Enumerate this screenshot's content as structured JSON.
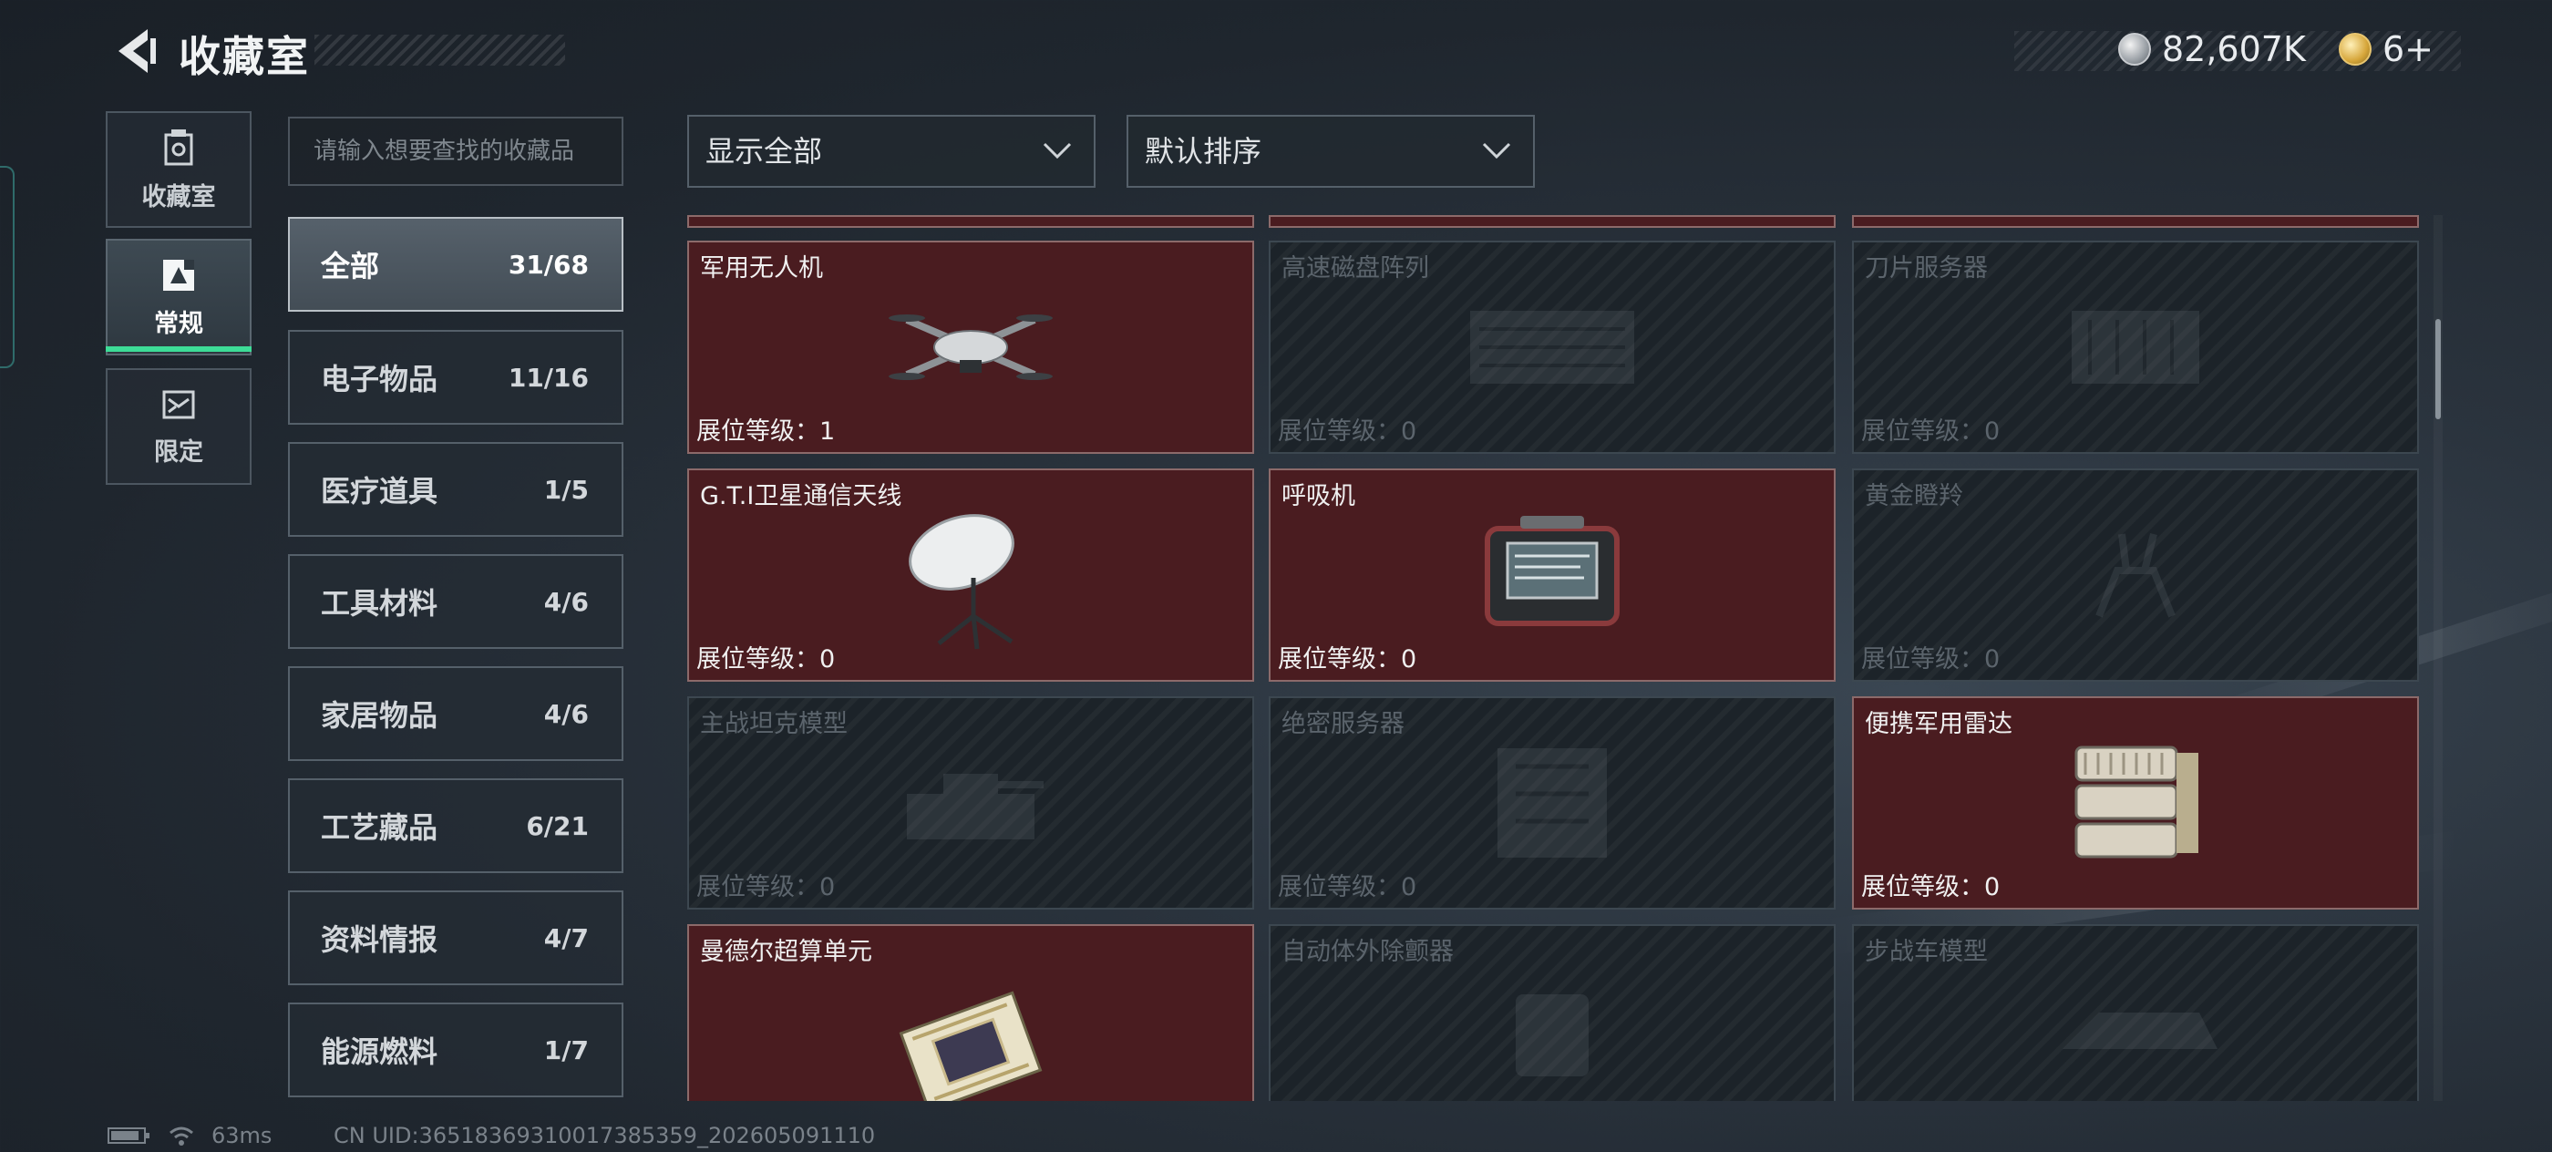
{
  "header": {
    "title": "收藏室",
    "currency": [
      {
        "icon": "silver-coin-icon",
        "value": "82,607K"
      },
      {
        "icon": "gold-coin-icon",
        "value": "6+"
      }
    ]
  },
  "left_nav": [
    {
      "label": "收藏室",
      "icon": "collection-icon",
      "active": false
    },
    {
      "label": "常规",
      "icon": "regular-icon",
      "active": true
    },
    {
      "label": "限定",
      "icon": "limited-icon",
      "active": false
    }
  ],
  "search": {
    "placeholder": "请输入想要查找的收藏品"
  },
  "categories": [
    {
      "name": "全部",
      "count": "31/68",
      "active": true
    },
    {
      "name": "电子物品",
      "count": "11/16",
      "active": false
    },
    {
      "name": "医疗道具",
      "count": "1/5",
      "active": false
    },
    {
      "name": "工具材料",
      "count": "4/6",
      "active": false
    },
    {
      "name": "家居物品",
      "count": "4/6",
      "active": false
    },
    {
      "name": "工艺藏品",
      "count": "6/21",
      "active": false
    },
    {
      "name": "资料情报",
      "count": "4/7",
      "active": false
    },
    {
      "name": "能源燃料",
      "count": "1/7",
      "active": false
    }
  ],
  "filters": {
    "display": "显示全部",
    "sort": "默认排序"
  },
  "level_label": "展位等级：",
  "items": [
    {
      "name": "军用无人机",
      "level": "1",
      "owned": true,
      "art": "drone"
    },
    {
      "name": "高速磁盘阵列",
      "level": "0",
      "owned": false,
      "art": "disk"
    },
    {
      "name": "刀片服务器",
      "level": "0",
      "owned": false,
      "art": "server"
    },
    {
      "name": "G.T.I卫星通信天线",
      "level": "0",
      "owned": true,
      "art": "dish"
    },
    {
      "name": "呼吸机",
      "level": "0",
      "owned": true,
      "art": "ventilator"
    },
    {
      "name": "黄金瞪羚",
      "level": "0",
      "owned": false,
      "art": "gazelle"
    },
    {
      "name": "主战坦克模型",
      "level": "0",
      "owned": false,
      "art": "tank"
    },
    {
      "name": "绝密服务器",
      "level": "0",
      "owned": false,
      "art": "secret-server"
    },
    {
      "name": "便携军用雷达",
      "level": "0",
      "owned": true,
      "art": "radar"
    },
    {
      "name": "曼德尔超算单元",
      "level": "",
      "owned": true,
      "art": "gpu"
    },
    {
      "name": "自动体外除颤器",
      "level": "",
      "owned": false,
      "art": "aed"
    },
    {
      "name": "步战车模型",
      "level": "",
      "owned": false,
      "art": "ifv"
    }
  ],
  "status": {
    "ping": "63ms",
    "uid": "CN UID:36518369310017385359_202605091110"
  }
}
